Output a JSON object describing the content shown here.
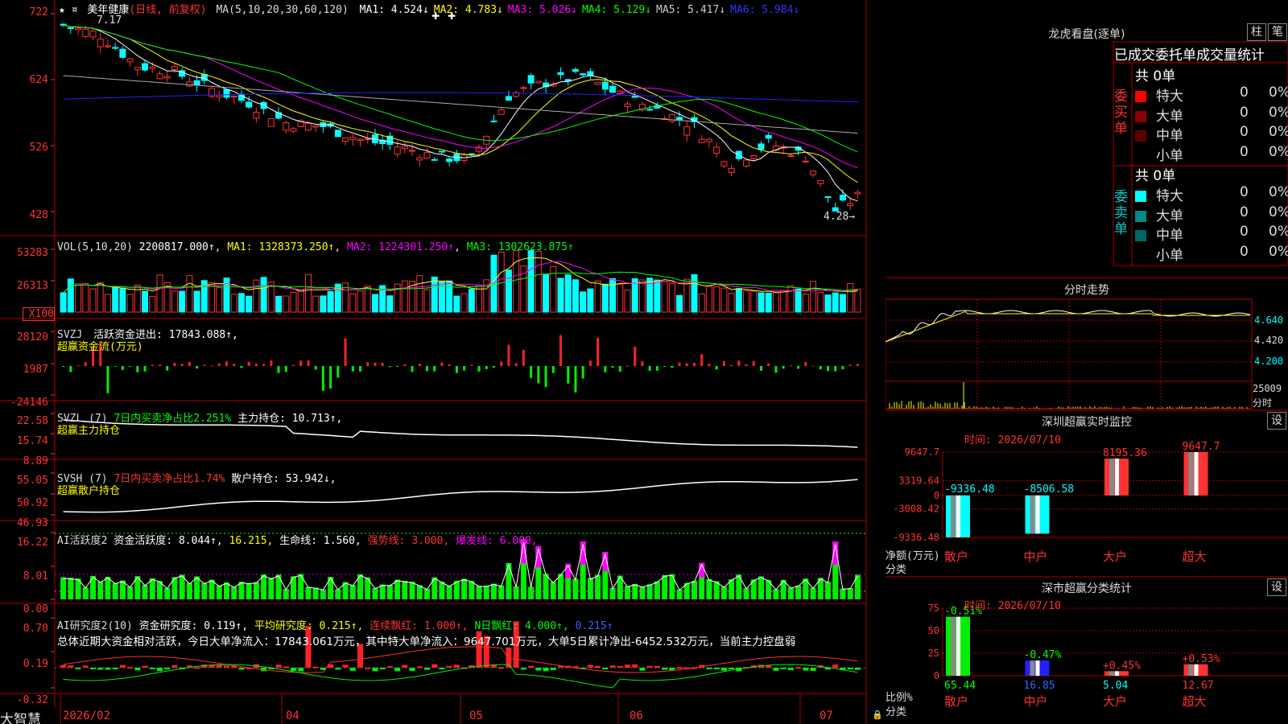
{
  "app": {
    "name": "大智慧"
  },
  "stock": {
    "marks": "★ ¤",
    "name": "美年健康",
    "period": "(日线, 前复权)"
  },
  "main": {
    "ma_label": "MA(5,10,20,30,60,120)",
    "ma_values": [
      {
        "label": "MA1: 4.524↓",
        "color": "#ffffff"
      },
      {
        "label": "MA2: 4.783↓",
        "color": "#ffff00"
      },
      {
        "label": "MA3: 5.026↓",
        "color": "#ff00ff"
      },
      {
        "label": "MA4: 5.129↓",
        "color": "#00ff00"
      },
      {
        "label": "MA5: 5.417↓",
        "color": "#cccccc"
      },
      {
        "label": "MA6: 5.984↓",
        "color": "#3333ff"
      }
    ],
    "high_label": "7.17",
    "low_label": "4.28→",
    "axis": [
      "722",
      "624",
      "526",
      "428"
    ]
  },
  "vol": {
    "title": "VOL(5,10,20)",
    "value": "2200817.000↑",
    "ma1": "MA1: 1328373.250↑",
    "ma2": "MA2: 1224301.250↑",
    "ma3": "MA3: 1302623.875↑",
    "axis": [
      "53283",
      "26313",
      "X100"
    ]
  },
  "svzj": {
    "title": "SVZJ",
    "line1": "活跃资金进出: 17843.088↑,",
    "line2": "超赢资金流(万元)",
    "axis": [
      "28120",
      "1987",
      "-24146"
    ]
  },
  "svzl": {
    "title": "SVZL (7)",
    "net": "7日内买卖净占比2.251%",
    "hold": "主力持仓: 10.713↑,",
    "line2": "超赢主力持仓",
    "axis": [
      "22.58",
      "15.74",
      "8.89"
    ]
  },
  "svsh": {
    "title": "SVSH (7)",
    "net": "7日内买卖净占比1.74%",
    "hold": "散户持仓: 53.942↓,",
    "line2": "超赢散户持仓",
    "axis": [
      "55.05",
      "50.92",
      "46.93"
    ]
  },
  "ai1": {
    "title": "AI活跃度2",
    "a": "资金活跃度: 8.044↑,",
    "b": "16.215,",
    "c": "生命线: 1.560,",
    "d": "强势线: 3.000,",
    "e": "爆发线: 6.000,",
    "axis": [
      "16.22",
      "8.01",
      "0.00"
    ]
  },
  "ai2": {
    "title": "AI研究度2(10)",
    "a": "资金研究度: 0.119↑,",
    "b": "平均研究度: 0.215↑,",
    "c": "连续飘红: 1.000↑,",
    "d": "N日飘红: 4.000↑,",
    "e": "0.215↑",
    "summary": "总体近期大资金相对活跃，今日大单净流入：17843.061万元，其中特大单净流入：9647.701万元，大单5日累计净出-6452.532万元，当前主力控盘弱",
    "axis": [
      "0.70",
      "0.19",
      "-0.32"
    ]
  },
  "dates": [
    "2026/02",
    "04",
    "05",
    "06",
    "07"
  ],
  "lhb": {
    "title": "龙虎看盘(逐单)",
    "btn1": "柱",
    "btn2": "笔",
    "subtitle": "已成交委托单成交量统计",
    "buy_label": "委买单",
    "sell_label": "委卖单",
    "buy_total": "共 0单",
    "sell_total": "共 0单",
    "buy_rows": [
      {
        "name": "特大",
        "qty": "0",
        "pct": "0%",
        "color": "#ff0000"
      },
      {
        "name": "大单",
        "qty": "0",
        "pct": "0%",
        "color": "#8b0000"
      },
      {
        "name": "中单",
        "qty": "0",
        "pct": "0%",
        "color": "#5a0000"
      },
      {
        "name": "小单",
        "qty": "0",
        "pct": "0%",
        "color": "#000000"
      }
    ],
    "sell_rows": [
      {
        "name": "特大",
        "qty": "0",
        "pct": "0%",
        "color": "#00ffff"
      },
      {
        "name": "大单",
        "qty": "0",
        "pct": "0%",
        "color": "#008b8b"
      },
      {
        "name": "中单",
        "qty": "0",
        "pct": "0%",
        "color": "#006666"
      },
      {
        "name": "小单",
        "qty": "0",
        "pct": "0%",
        "color": "#000000"
      }
    ]
  },
  "intraday": {
    "title": "分时走势",
    "axis": [
      "4.640",
      "4.420",
      "4.200"
    ],
    "vol_label": "25009",
    "vol_unit": "分时"
  },
  "sz_monitor": {
    "title": "深圳超赢实时监控",
    "btn": "设",
    "time": "时间: 2026/07/10",
    "ylabel": "净额(万元)",
    "xlabel": "分类",
    "axis": [
      "9647.7",
      "3319.64",
      "0",
      "-3008.42",
      "-9336.48"
    ]
  },
  "sz_class": {
    "title": "深市超赢分类统计",
    "btn": "设",
    "time": "时间: 2026/07/10",
    "ylabel": "比例%",
    "xlabel": "分类",
    "axis": [
      "75",
      "50",
      "25",
      "0"
    ]
  },
  "chart_data": [
    {
      "type": "bar",
      "title": "深圳超赢实时监控",
      "ylabel": "净额(万元)",
      "xlabel": "分类",
      "categories": [
        "散户",
        "中户",
        "大户",
        "超大"
      ],
      "values": [
        -9336.48,
        -8506.58,
        8195.36,
        9647.7
      ],
      "value_labels": [
        "-9336.48",
        "-8506.58",
        "8195.36",
        "9647.7"
      ],
      "ylim": [
        -9336.48,
        9647.7
      ]
    },
    {
      "type": "bar",
      "title": "深市超赢分类统计",
      "ylabel": "比例%",
      "xlabel": "分类",
      "categories": [
        "散户",
        "中户",
        "大户",
        "超大"
      ],
      "values": [
        65.44,
        16.85,
        5.04,
        12.67
      ],
      "value_labels": [
        "65.44",
        "16.85",
        "5.04",
        "12.67"
      ],
      "change_labels": [
        "-0.51%",
        "-0.47%",
        "+0.45%",
        "+0.53%"
      ],
      "ylim": [
        0,
        75
      ]
    }
  ]
}
